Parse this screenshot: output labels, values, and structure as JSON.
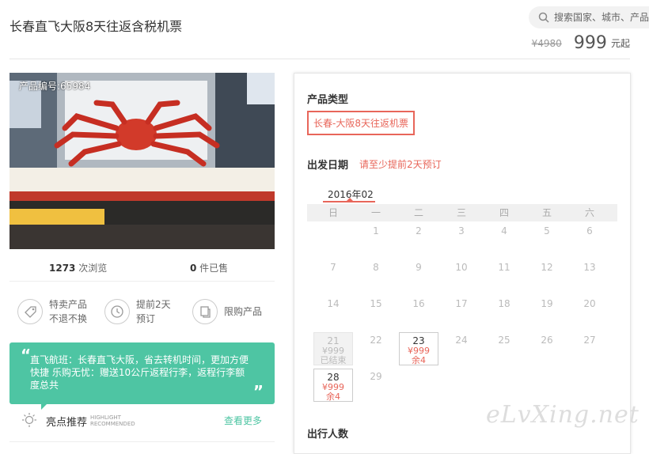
{
  "header": {
    "title": "长春直飞大阪8天往返含税机票",
    "search_placeholder": "搜索国家、城市、产品",
    "old_price": "¥4980",
    "price": "999",
    "price_suffix": "元起"
  },
  "left": {
    "product_id_label": "产品编号:65984",
    "stats": {
      "views_num": "1273",
      "views_label": " 次浏览",
      "sold_num": "0",
      "sold_label": " 件已售"
    },
    "features": [
      {
        "icon": "tag-icon",
        "line1": "特卖产品",
        "line2": "不退不换"
      },
      {
        "icon": "clock-icon",
        "line1": "提前2天",
        "line2": "预订"
      },
      {
        "icon": "copy-icon",
        "line1": "限购产品",
        "line2": ""
      }
    ],
    "highlight_text": "直飞航班：长春直飞大阪，省去转机时间，更加方便快捷 乐购无忧：赠送10公斤返程行李，返程行李额度总共",
    "highlight_label": "亮点推荐",
    "highlight_sub": "HIGHLIGHT RECOMMENDED",
    "see_more": "查看更多"
  },
  "panel": {
    "product_type_label": "产品类型",
    "product_type_option": "长春-大阪8天往返机票",
    "departure_label": "出发日期",
    "departure_hint": "请至少提前2天预订",
    "month": "2016年02",
    "weekdays": [
      "日",
      "一",
      "二",
      "三",
      "四",
      "五",
      "六"
    ],
    "weeks": [
      [
        "",
        "1",
        "2",
        "3",
        "4",
        "5",
        "6"
      ],
      [
        "7",
        "8",
        "9",
        "10",
        "11",
        "12",
        "13"
      ],
      [
        "14",
        "15",
        "16",
        "17",
        "18",
        "19",
        "20"
      ],
      [
        "21",
        "22",
        "23",
        "24",
        "25",
        "26",
        "27"
      ],
      [
        "28",
        "29",
        "",
        "",
        "",
        "",
        ""
      ]
    ],
    "past_day": {
      "day": "21",
      "price": "¥999",
      "status": "已结束"
    },
    "available_days": [
      {
        "day": "23",
        "price": "¥999",
        "remain": "余4"
      },
      {
        "day": "28",
        "price": "¥999",
        "remain": "余4"
      }
    ],
    "travelers_label": "出行人数"
  },
  "watermark": "eLvXing.net",
  "colors": {
    "accent": "#e8665a",
    "green": "#4ec5a3"
  }
}
